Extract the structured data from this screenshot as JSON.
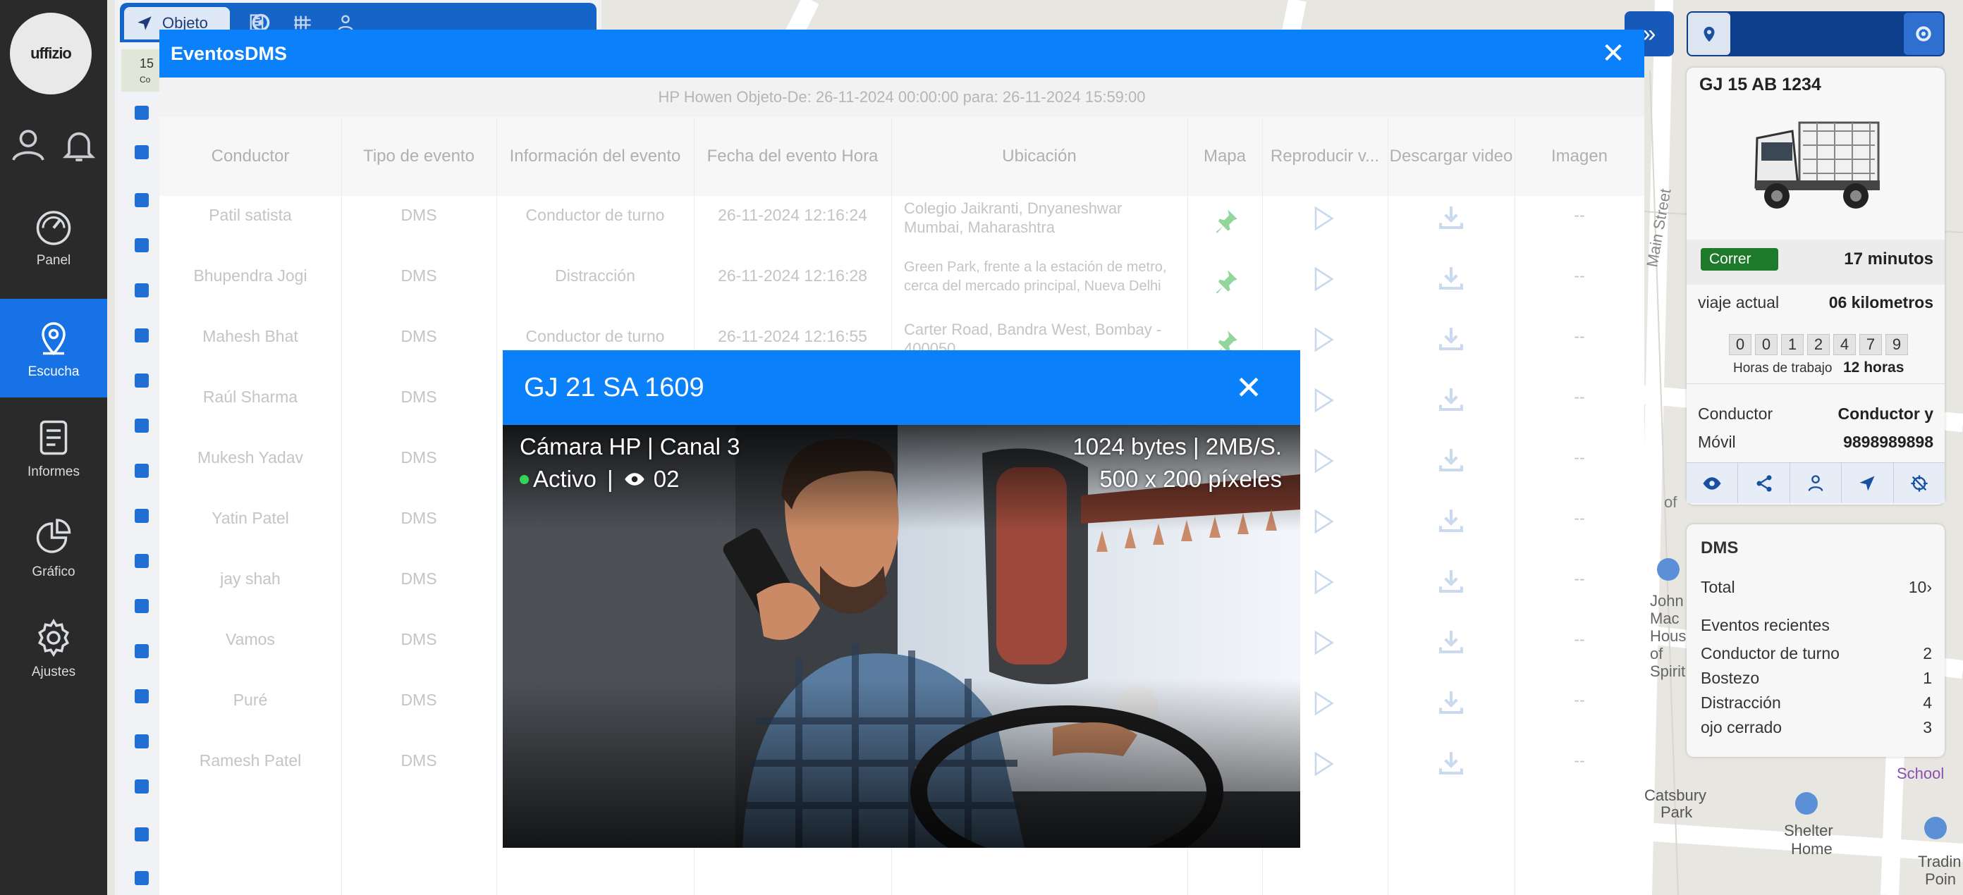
{
  "sidebar": {
    "logo_text": "uffizio",
    "items": [
      {
        "label": "Panel",
        "icon": "speedometer-icon"
      },
      {
        "label": "Escucha",
        "icon": "location-pin-icon",
        "active": true
      },
      {
        "label": "Informes",
        "icon": "document-icon"
      },
      {
        "label": "Gráfico",
        "icon": "pie-chart-icon"
      },
      {
        "label": "Ajustes",
        "icon": "gear-icon"
      }
    ]
  },
  "object_panel": {
    "tab_label": "Objeto",
    "count_stub": "15",
    "count_sub": "Co"
  },
  "vehicle_card": {
    "plate": "GJ 15 AB 1234",
    "status": "Correr",
    "status_time": "17 minutos",
    "trip_label": "viaje actual",
    "trip_value": "06 kilometros",
    "odometer": [
      "0",
      "0",
      "1",
      "2",
      "4",
      "7",
      "9"
    ],
    "work_hours_label": "Horas de trabajo",
    "work_hours_value": "12 horas",
    "driver_label": "Conductor",
    "driver_value": "Conductor y",
    "mobile_label": "Móvil",
    "mobile_value": "9898989898"
  },
  "dms_card": {
    "title": "DMS",
    "total_label": "Total",
    "total_value": "10",
    "recent_label": "Eventos recientes",
    "events": [
      {
        "label": "Conductor de turno",
        "count": "2"
      },
      {
        "label": "Bostezo",
        "count": "1"
      },
      {
        "label": "Distracción",
        "count": "4"
      },
      {
        "label": "ojo cerrado",
        "count": "3"
      }
    ]
  },
  "events_modal": {
    "title": "EventosDMS",
    "subtitle": "HP Howen Objeto-De: 26-11-2024 00:00:00 para: 26-11-2024 15:59:00",
    "columns": [
      "Conductor",
      "Tipo de evento",
      "Información del evento",
      "Fecha del evento Hora",
      "Ubicación",
      "Mapa",
      "Reproducir v...",
      "Descargar video",
      "Imagen"
    ],
    "rows": [
      {
        "driver": "Patil satista",
        "type": "DMS",
        "info": "Conductor de turno",
        "datetime": "26-11-2024 12:16:24",
        "location": "Colegio Jaikranti, Dnyaneshwar Mumbai, Maharashtra",
        "image": "--"
      },
      {
        "driver": "Bhupendra Jogi",
        "type": "DMS",
        "info": "Distracción",
        "datetime": "26-11-2024 12:16:28",
        "location": "Green Park, frente a la estación de metro, cerca del mercado principal, Nueva Delhi",
        "image": "--"
      },
      {
        "driver": "Mahesh Bhat",
        "type": "DMS",
        "info": "Conductor de turno",
        "datetime": "26-11-2024 12:16:55",
        "location": "Carter Road, Bandra West, Bombay - 400050",
        "image": "--"
      },
      {
        "driver": "Raúl Sharma",
        "type": "DMS",
        "image": "--"
      },
      {
        "driver": "Mukesh Yadav",
        "type": "DMS",
        "image": "--"
      },
      {
        "driver": "Yatin Patel",
        "type": "DMS",
        "image": "--"
      },
      {
        "driver": "jay shah",
        "type": "DMS",
        "image": "--"
      },
      {
        "driver": "Vamos",
        "type": "DMS",
        "image": "--"
      },
      {
        "driver": "Puré",
        "type": "DMS",
        "image": "--"
      },
      {
        "driver": "Ramesh Patel",
        "type": "DMS",
        "image": "--"
      }
    ]
  },
  "camera_modal": {
    "title": "GJ 21 SA 1609",
    "camera_label": "Cámara HP",
    "channel_label": "Canal 3",
    "status": "Activo",
    "viewers": "02",
    "bitrate": "1024 bytes",
    "speed": "2MB/S.",
    "resolution": "500 x 200 píxeles"
  },
  "map": {
    "labels": [
      "Shelter Home",
      "Catsbury Park",
      "School",
      "Tradin Poin",
      "Main Street"
    ]
  },
  "colors": {
    "primary_blue": "#0a80fa",
    "sidebar_bg": "#2a2a2a",
    "active_blue": "#1672e5",
    "run_green": "#1c7a2a",
    "status_dot": "#34d35a"
  }
}
